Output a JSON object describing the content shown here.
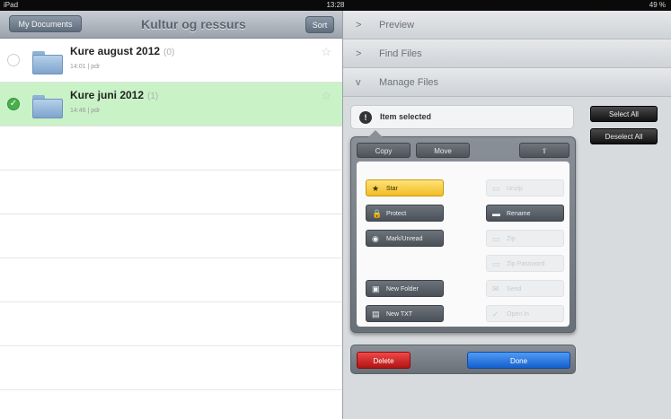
{
  "status_bar": {
    "device": "iPad",
    "time": "13:28",
    "battery": "49 %"
  },
  "left_nav": {
    "back_label": "My Documents",
    "title": "Kultur og ressurs",
    "sort_label": "Sort"
  },
  "files": [
    {
      "name": "Kure august 2012",
      "count": "(0)",
      "meta": "14:01 | pdr",
      "selected": false
    },
    {
      "name": "Kure juni 2012",
      "count": "(1)",
      "meta": "14:46 | pdr",
      "selected": true
    }
  ],
  "sections": {
    "preview": {
      "label": "Preview",
      "chevron": ">"
    },
    "find": {
      "label": "Find Files",
      "chevron": ">"
    },
    "manage": {
      "label": "Manage Files",
      "chevron": "v"
    }
  },
  "manage": {
    "selection_text": "Item selected",
    "info_glyph": "!",
    "select_all": "Select All",
    "deselect_all": "Deselect All",
    "copy": "Copy",
    "move": "Move",
    "share_glyph": "⇪",
    "actions": {
      "star": "Star",
      "protect": "Protect",
      "mark_unread": "Mark/Unread",
      "new_folder": "New Folder",
      "new_txt": "New TXT",
      "action1": "Unzip",
      "rename": "Rename",
      "action3": "Zip",
      "action4": "Zip Password",
      "action5": "Send",
      "action6": "Open In"
    },
    "delete": "Delete",
    "done": "Done"
  }
}
